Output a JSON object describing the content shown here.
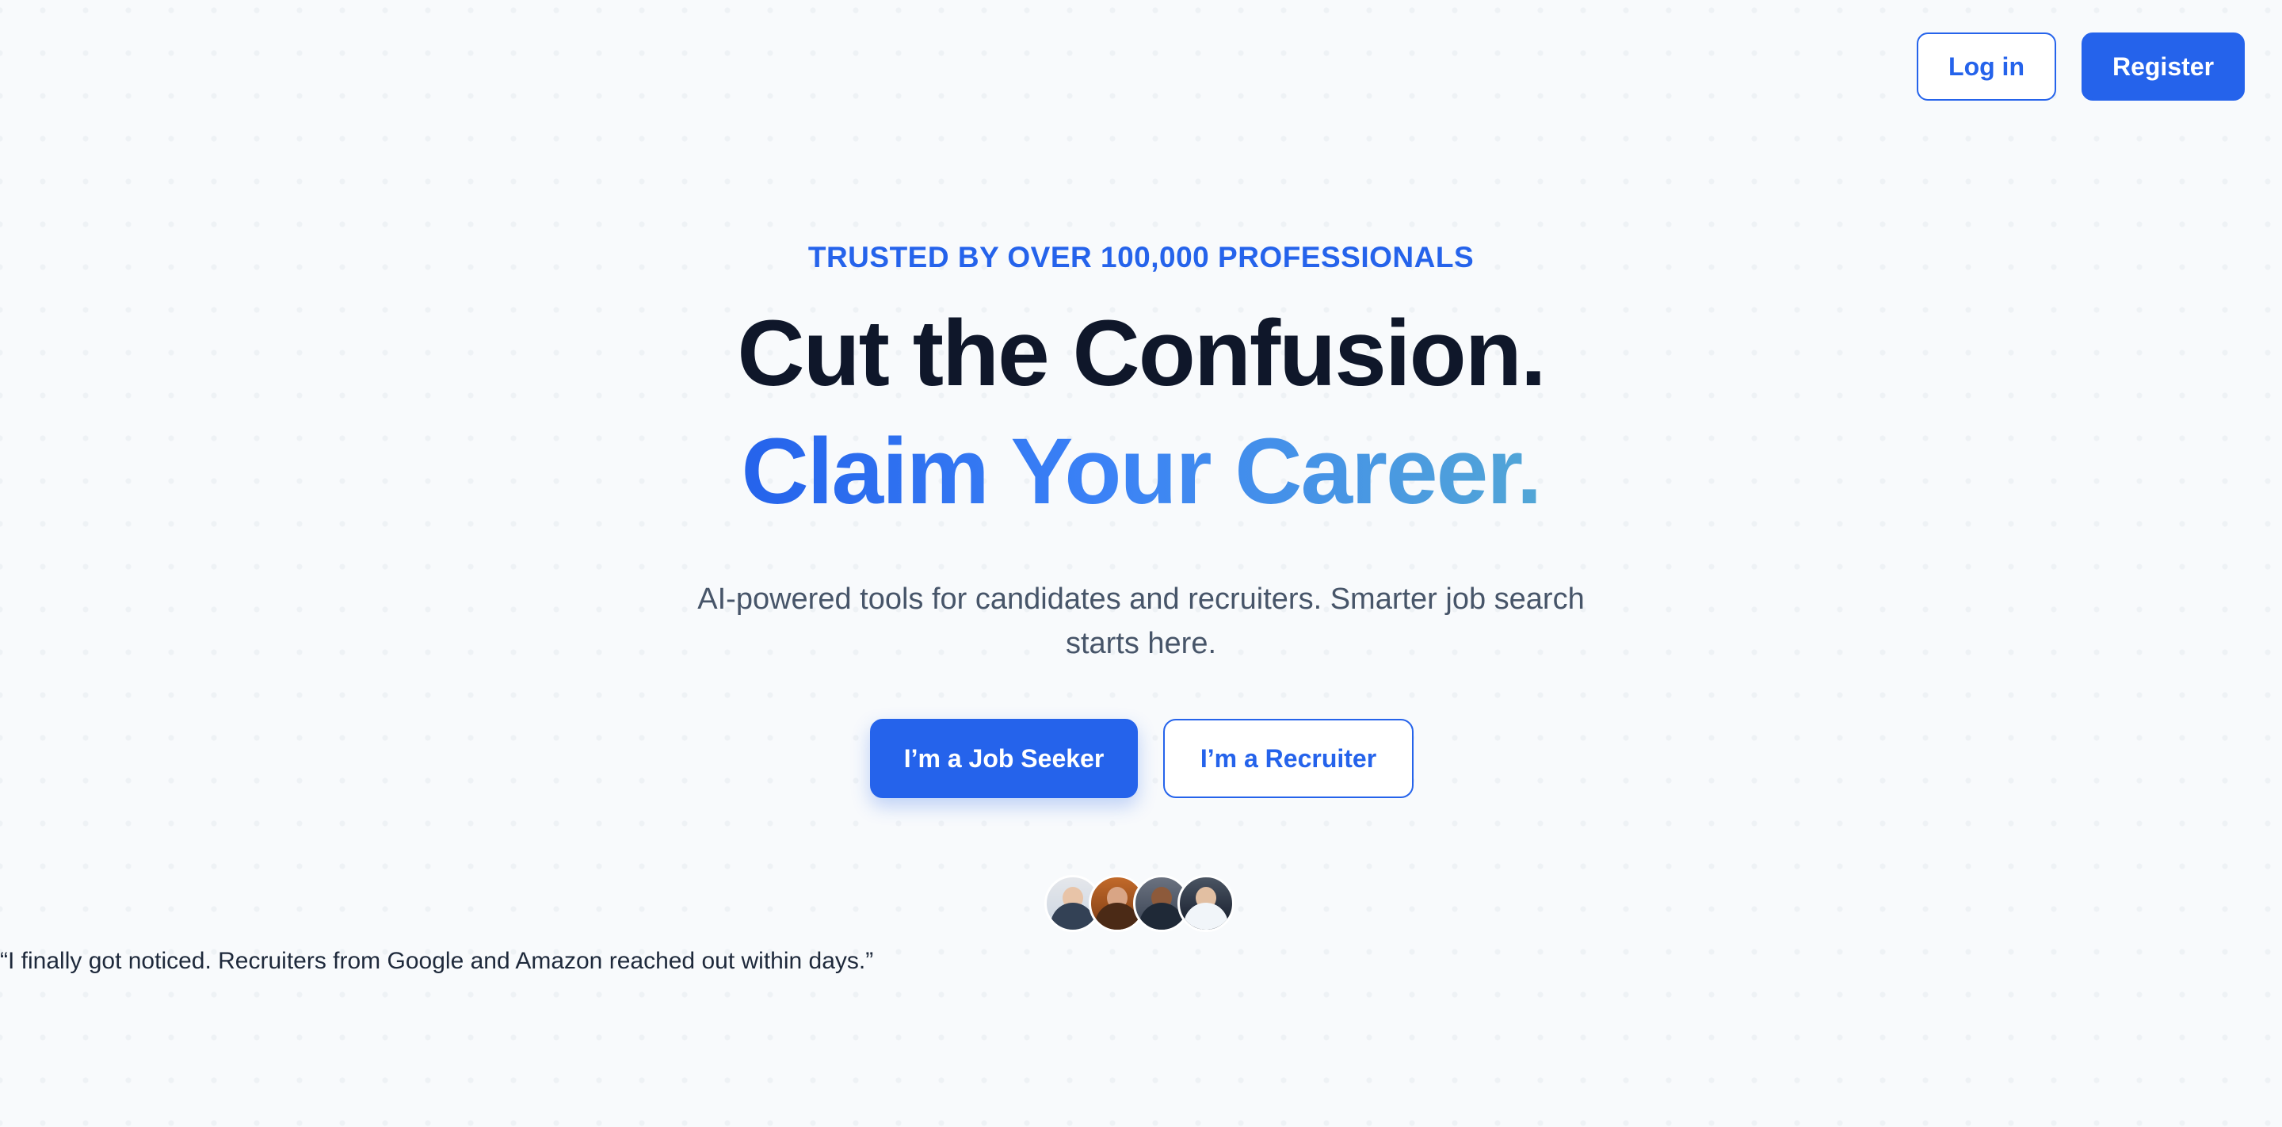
{
  "nav": {
    "login_label": "Log in",
    "register_label": "Register"
  },
  "hero": {
    "eyebrow": "TRUSTED BY OVER 100,000 PROFESSIONALS",
    "title_line1": "Cut the Confusion.",
    "title_line2": "Claim Your Career.",
    "subtitle": "AI-powered tools for candidates and recruiters. Smarter job search starts here.",
    "cta_job_seeker": "I’m a Job Seeker",
    "cta_recruiter": "I’m a Recruiter"
  },
  "testimonial": {
    "quote": "“I finally got noticed. Recruiters from Google and Amazon reached out within days.”",
    "avatars": [
      {
        "name": "avatar-man-glasses-icon"
      },
      {
        "name": "avatar-woman-icon"
      },
      {
        "name": "avatar-man-suit-icon"
      },
      {
        "name": "avatar-woman-laptop-icon"
      }
    ]
  },
  "colors": {
    "primary": "#2563eb",
    "heading": "#0f172a",
    "body": "#475569",
    "gradient_end": "#52a6d6",
    "background": "#f8fafc"
  }
}
